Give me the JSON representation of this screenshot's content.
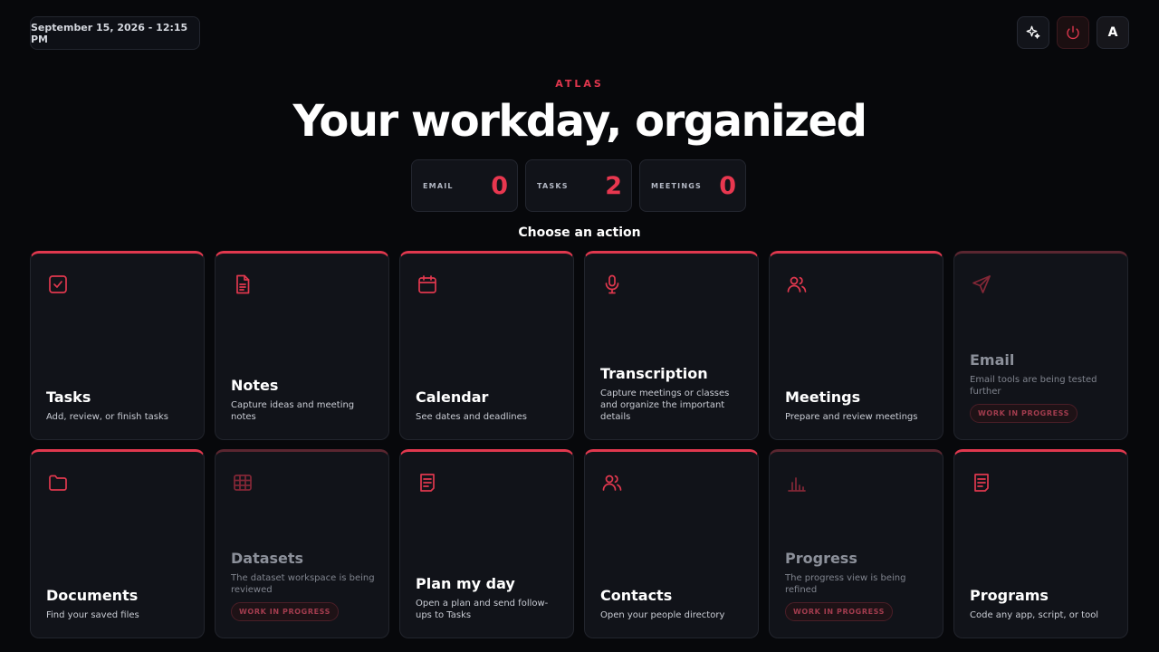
{
  "header": {
    "datetime": "September 15, 2026 - 12:15 PM",
    "avatar_initial": "A"
  },
  "brand": "ATLAS",
  "title": "Your workday, organized",
  "counters": [
    {
      "label": "EMAIL",
      "value": "0"
    },
    {
      "label": "TASKS",
      "value": "2"
    },
    {
      "label": "MEETINGS",
      "value": "0"
    }
  ],
  "subhead": "Choose an action",
  "badge_label": "WORK IN PROGRESS",
  "cards": [
    {
      "title": "Tasks",
      "desc": "Add, review, or finish tasks",
      "icon": "checkbox-icon"
    },
    {
      "title": "Notes",
      "desc": "Capture ideas and meeting notes",
      "icon": "document-icon"
    },
    {
      "title": "Calendar",
      "desc": "See dates and deadlines",
      "icon": "calendar-icon"
    },
    {
      "title": "Transcription",
      "desc": "Capture meetings or classes and organize the important details",
      "icon": "microphone-icon"
    },
    {
      "title": "Meetings",
      "desc": "Prepare and review meetings",
      "icon": "people-icon"
    },
    {
      "title": "Email",
      "desc": "Email tools are being tested further",
      "icon": "send-icon",
      "wip": true
    },
    {
      "title": "Documents",
      "desc": "Find your saved files",
      "icon": "folder-icon"
    },
    {
      "title": "Datasets",
      "desc": "The dataset workspace is being reviewed",
      "icon": "table-icon",
      "wip": true
    },
    {
      "title": "Plan my day",
      "desc": "Open a plan and send follow-ups to Tasks",
      "icon": "list-icon"
    },
    {
      "title": "Contacts",
      "desc": "Open your people directory",
      "icon": "people-icon"
    },
    {
      "title": "Progress",
      "desc": "The progress view is being refined",
      "icon": "bar-chart-icon",
      "wip": true
    },
    {
      "title": "Programs",
      "desc": "Code any app, script, or tool",
      "icon": "list-icon"
    }
  ],
  "colors": {
    "accent": "#e0384e",
    "background": "#07080b",
    "card": "#111319"
  }
}
